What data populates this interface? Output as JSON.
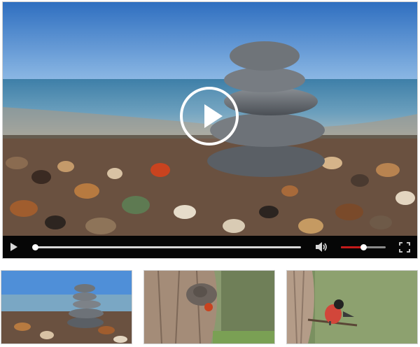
{
  "player": {
    "scene": "beach-stone-cairn",
    "progress_fraction": 0.0,
    "volume_fraction": 0.5,
    "accent_color": "#c41a1a",
    "icons": {
      "overlay": "play-circle-icon",
      "play": "play-icon",
      "volume": "speaker-icon",
      "fullscreen": "fullscreen-icon"
    }
  },
  "playlist": {
    "thumbnails": [
      {
        "scene": "beach-stone-cairn"
      },
      {
        "scene": "squirrel-on-tree-trunk"
      },
      {
        "scene": "bullfinch-on-branch"
      }
    ]
  }
}
